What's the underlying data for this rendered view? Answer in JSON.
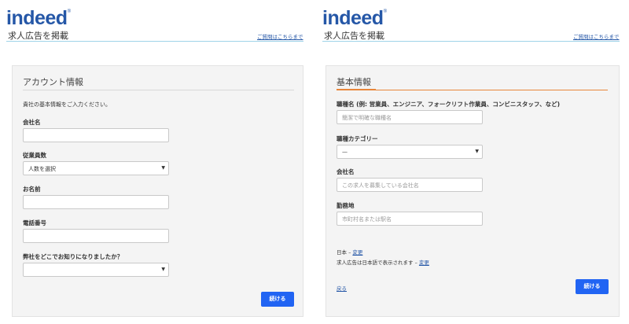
{
  "left": {
    "logo": "indeed",
    "subtitle": "求人広告を掲載",
    "contact_link": "ご質問はこちらまで",
    "card_title": "アカウント情報",
    "intro": "貴社の基本情報をご入力ください。",
    "fields": {
      "company_label": "会社名",
      "employees_label": "従業員数",
      "employees_value": "人数を選択",
      "name_label": "お名前",
      "phone_label": "電話番号",
      "source_label": "弊社をどこでお知りになりましたか？",
      "source_value": ""
    },
    "continue_button": "続ける"
  },
  "right": {
    "logo": "indeed",
    "subtitle": "求人広告を掲載",
    "contact_link": "ご質問はこちらまで",
    "card_title": "基本情報",
    "fields": {
      "job_title_label": "職種名 (例: 営業員、エンジニア、フォークリフト作業員、コンビニスタッフ、など)",
      "job_title_placeholder": "簡潔で明確な職種名",
      "category_label": "職種カテゴリー",
      "category_value": "—",
      "company_label": "会社名",
      "company_placeholder": "この求人を募集している会社名",
      "location_label": "勤務地",
      "location_placeholder": "市町村名または駅名"
    },
    "country_text": "日本 –",
    "country_change": "変更",
    "language_text": "求人広告は日本語で表示されます –",
    "language_change": "変更",
    "back_link": "戻る",
    "continue_button": "続ける"
  },
  "colors": {
    "brand": "#2557a7",
    "button": "#2164f3",
    "accent": "#e8863a"
  }
}
